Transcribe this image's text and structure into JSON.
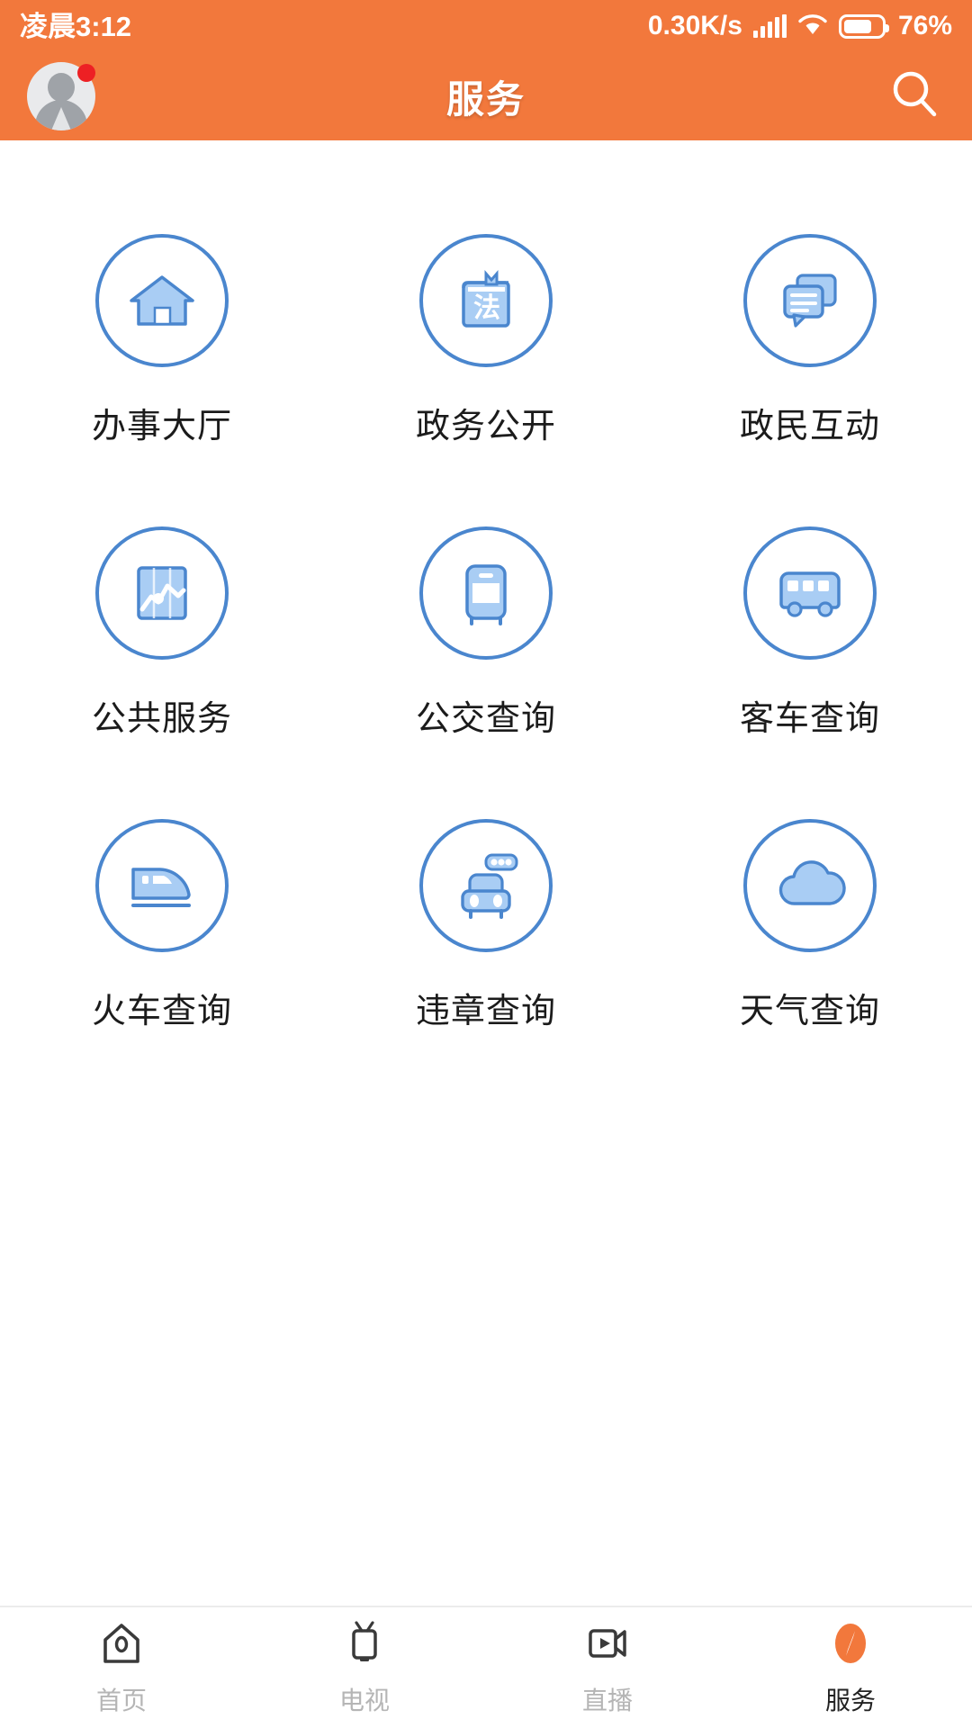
{
  "status_bar": {
    "time": "凌晨3:12",
    "network_speed": "0.30K/s",
    "battery_percent": "76%",
    "signal_icon": "signal-bars-icon",
    "wifi_icon": "wifi-icon",
    "battery_icon": "battery-icon"
  },
  "header": {
    "title": "服务",
    "avatar_icon": "user-avatar",
    "notification_badge": "",
    "search_icon": "search-icon",
    "background_color": "#F2783C"
  },
  "services": {
    "icon_stroke_color": "#4A86CE",
    "icon_fill_color": "#A9CDF4",
    "items": [
      {
        "label": "办事大厅",
        "icon": "house-icon"
      },
      {
        "label": "政务公开",
        "icon": "law-book-icon"
      },
      {
        "label": "政民互动",
        "icon": "chat-bubbles-icon"
      },
      {
        "label": "公共服务",
        "icon": "chart-graph-icon"
      },
      {
        "label": "公交查询",
        "icon": "bus-front-icon"
      },
      {
        "label": "客车查询",
        "icon": "coach-bus-icon"
      },
      {
        "label": "火车查询",
        "icon": "train-icon"
      },
      {
        "label": "违章查询",
        "icon": "car-traffic-light-icon"
      },
      {
        "label": "天气查询",
        "icon": "cloud-icon"
      }
    ]
  },
  "tabbar": {
    "active_color": "#F2783C",
    "inactive_color": "#B5B5B5",
    "items": [
      {
        "label": "首页",
        "icon": "home-icon",
        "active": false
      },
      {
        "label": "电视",
        "icon": "tv-icon",
        "active": false
      },
      {
        "label": "直播",
        "icon": "live-video-icon",
        "active": false
      },
      {
        "label": "服务",
        "icon": "compass-icon",
        "active": true
      }
    ]
  }
}
